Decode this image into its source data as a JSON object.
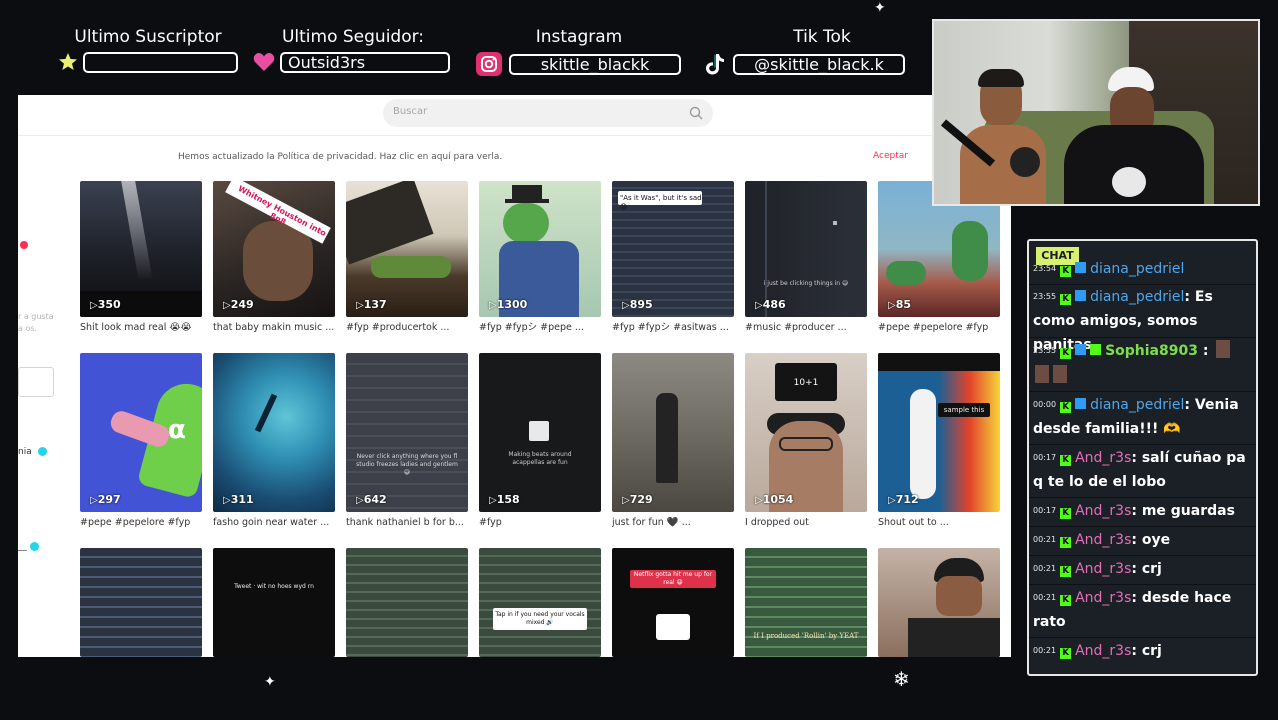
{
  "overlay": {
    "subscriber_label": "Ultimo Suscriptor",
    "subscriber_value": "",
    "follower_label": "Ultimo Seguidor:",
    "follower_value": "Outsid3rs",
    "instagram_label": "Instagram",
    "instagram_value": "skittle_blackk",
    "tiktok_label": "Tik Tok",
    "tiktok_value": "@skittle_black.k"
  },
  "browser": {
    "search_placeholder": "Buscar",
    "privacy_notice": "Hemos actualizado la Política de privacidad. Haz clic en aquí para verla.",
    "accept_label": "Aceptar",
    "sidebar_fragment": "r a gusta a os.",
    "sidebar_name_fragment": "nia"
  },
  "videos": [
    {
      "views": "350",
      "caption": "Shit look mad real 😭😭"
    },
    {
      "views": "249",
      "caption": "that baby makin music ...",
      "overlay_text": "Whitney Houston into 8n8"
    },
    {
      "views": "137",
      "caption": "#fyp #producertok ..."
    },
    {
      "views": "1300",
      "caption": "#fyp #fypシ #pepe ..."
    },
    {
      "views": "895",
      "caption": "#fyp #fypシ #asitwas ...",
      "overlay_text": "\"As it Was\", but it's sad 😞"
    },
    {
      "views": "486",
      "caption": "#music #producer ...",
      "overlay_text": "i just be clicking things in 😅"
    },
    {
      "views": "85",
      "caption": "#pepe #pepelore #fyp"
    },
    {
      "views": "297",
      "caption": "#pepe #pepelore #fyp"
    },
    {
      "views": "311",
      "caption": "fasho goin near water ..."
    },
    {
      "views": "642",
      "caption": "thank nathaniel b for b...",
      "overlay_text": "Never click anything where you fl studio freezes ladies and gentlem 😅"
    },
    {
      "views": "158",
      "caption": "#fyp",
      "overlay_text": "Making beats around acappellas are fun"
    },
    {
      "views": "729",
      "caption": "just for fun 🖤 ..."
    },
    {
      "views": "1054",
      "caption": "I dropped out",
      "overlay_text": "10+1"
    },
    {
      "views": "712",
      "caption": "Shout out to ...",
      "overlay_text": "sample this"
    },
    {
      "views": "",
      "caption": ""
    },
    {
      "views": "",
      "caption": "",
      "overlay_text": "Tweet · wit no hoes wyd rn"
    },
    {
      "views": "",
      "caption": ""
    },
    {
      "views": "",
      "caption": "",
      "overlay_text": "Tap in if you need your vocals mixed 🔊"
    },
    {
      "views": "",
      "caption": "",
      "overlay_text": "Netflix gotta hit me up for real 😆"
    },
    {
      "views": "",
      "caption": "",
      "overlay_text": "If I produced 'Rollin' by YEAT"
    },
    {
      "views": "",
      "caption": ""
    }
  ],
  "chat": {
    "tag": "CHAT",
    "messages": [
      {
        "time": "23:54",
        "user": "diana_pedriel",
        "text": ""
      },
      {
        "time": "23:55",
        "user": "diana_pedriel",
        "text": ": Es como amigos, somos panitas"
      },
      {
        "time": "23:55",
        "user": "Sophia8903",
        "text": " :"
      },
      {
        "time": "00:00",
        "user": "diana_pedriel",
        "text": ": Venia desde familia!!! 🫶"
      },
      {
        "time": "00:17",
        "user": "And_r3s",
        "text": ": salí cuñao pa q te lo de el lobo"
      },
      {
        "time": "00:17",
        "user": "And_r3s",
        "text": ": me guardas"
      },
      {
        "time": "00:21",
        "user": "And_r3s",
        "text": ": oye"
      },
      {
        "time": "00:21",
        "user": "And_r3s",
        "text": ": crj"
      },
      {
        "time": "00:21",
        "user": "And_r3s",
        "text": ": desde hace rato"
      },
      {
        "time": "00:21",
        "user": "And_r3s",
        "text": ": crj"
      }
    ]
  },
  "colors": {
    "accent_pink": "#fe2c55",
    "chat_tag": "#d8f070",
    "kick_green": "#53fc18",
    "user_blue": "#4fa6e8",
    "user_green": "#7fdc4b",
    "user_pink": "#e36fb7"
  }
}
